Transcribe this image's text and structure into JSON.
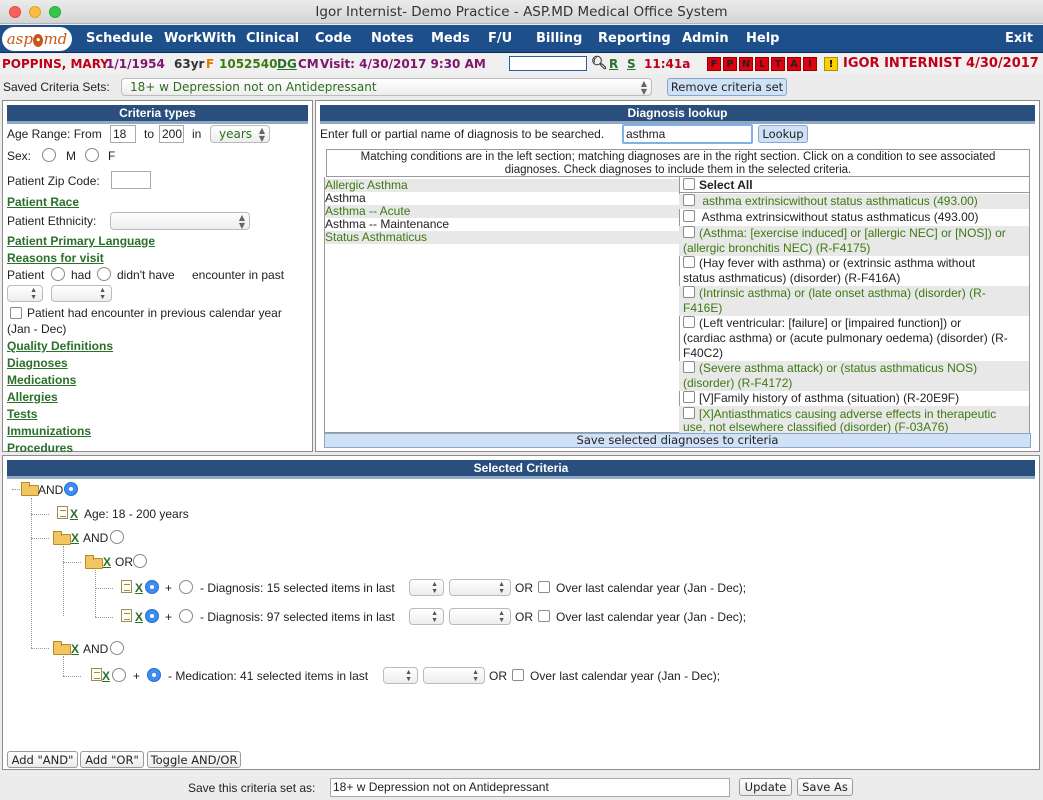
{
  "window": {
    "title": "Igor Internist- Demo Practice - ASP.MD Medical Office System"
  },
  "logo": {
    "text_left": "asp",
    "text_dot": "•",
    "text_right": "md"
  },
  "menu": [
    {
      "label": "Schedule"
    },
    {
      "label": "WorkWith"
    },
    {
      "label": "Clinical"
    },
    {
      "label": "Code"
    },
    {
      "label": "Notes"
    },
    {
      "label": "Meds"
    },
    {
      "label": "F/U"
    },
    {
      "label": "Billing"
    },
    {
      "label": "Reporting"
    },
    {
      "label": "Admin"
    },
    {
      "label": "Help"
    },
    {
      "label": "Exit"
    }
  ],
  "patient": {
    "name": "POPPINS, MARY",
    "dob": "1/1/1954",
    "age": "63yr",
    "sex": "F",
    "id": "1052540",
    "dg": "DG",
    "cm": "CM",
    "visit": "Visit: 4/30/2017 9:30 AM",
    "search_icon": "magnifier-icon",
    "r_link": "R",
    "s_link": "S",
    "time": "11:41a",
    "flags": [
      "F",
      "P",
      "N",
      "L",
      "T",
      "A",
      "I",
      "!"
    ],
    "provider": "IGOR INTERNIST 4/30/2017"
  },
  "saved": {
    "label": "Saved Criteria Sets:",
    "selected": "18+ w Depression not on Antidepressant",
    "remove_button": "Remove criteria set"
  },
  "criteria_types": {
    "header": "Criteria types",
    "age_label": "Age Range:  From",
    "age_from": "18",
    "to_label": "to",
    "age_to": "200",
    "in_label": "in",
    "unit": "years",
    "sex_label": "Sex:",
    "sex_m": "M",
    "sex_f": "F",
    "zip_label": "Patient Zip Code:",
    "race_link": "Patient Race",
    "ethnicity_label": "Patient Ethnicity:",
    "language_link": "Patient Primary Language",
    "reasons_link": "Reasons for visit",
    "patient_label": "Patient",
    "had_label": "had",
    "didnt_label": "didn't have",
    "encounter_label": "encounter in past",
    "prev_year_label": "Patient had encounter in previous calendar year",
    "prev_year_range": "(Jan - Dec)",
    "links": [
      "Quality Definitions",
      "Diagnoses",
      "Medications",
      "Allergies",
      "Tests",
      "Immunizations",
      "Procedures"
    ]
  },
  "diagnosis_lookup": {
    "header": "Diagnosis lookup",
    "prompt": "Enter full or partial name of diagnosis to be searched.",
    "query": "asthma",
    "lookup_button": "Lookup",
    "instructions_1": "Matching conditions are in the left section; matching diagnoses are in the right section. Click on a condition to see associated",
    "instructions_2": "diagnoses. Check diagnoses to include them in the selected criteria.",
    "conditions": [
      "Allergic Asthma",
      "Asthma",
      "Asthma -- Acute",
      "Asthma -- Maintenance",
      "Status Asthmaticus"
    ],
    "select_all": "Select All",
    "diagnoses": [
      {
        "lines": [
          "asthma extrinsicwithout status asthmaticus (493.00)"
        ]
      },
      {
        "lines": [
          "Asthma extrinsicwithout status asthmaticus (493.00)"
        ]
      },
      {
        "lines": [
          "(Asthma: [exercise induced] or [allergic NEC] or [NOS]) or",
          "(allergic bronchitis NEC) (R-F4175)"
        ]
      },
      {
        "lines": [
          "(Hay fever with asthma) or (extrinsic asthma without",
          "status asthmaticus) (disorder) (R-F416A)"
        ]
      },
      {
        "lines": [
          "(Intrinsic asthma) or (late onset asthma) (disorder) (R-",
          "F416E)"
        ]
      },
      {
        "lines": [
          "(Left ventricular: [failure] or [impaired function]) or",
          "(cardiac asthma) or (acute pulmonary oedema) (disorder) (R-",
          "F40C2)"
        ]
      },
      {
        "lines": [
          "(Severe asthma attack) or (status asthmaticus NOS)",
          "(disorder) (R-F4172)"
        ]
      },
      {
        "lines": [
          "[V]Family history of asthma (situation) (R-20E9F)"
        ]
      },
      {
        "lines": [
          "[X]Antiasthmatics causing adverse effects in therapeutic",
          "use, not elsewhere classified (disorder) (F-03A76)"
        ]
      }
    ],
    "save_button": "Save selected diagnoses to criteria"
  },
  "selected_criteria": {
    "header": "Selected Criteria",
    "root_op": "AND",
    "x": "X",
    "age_text": "Age: 18 - 200 years",
    "and_op": "AND",
    "or_op": "OR",
    "plus": "+",
    "minus": "-",
    "dx1_text": "- Diagnosis: 15 selected items in last",
    "dx2_text": "- Diagnosis: 97 selected items in last",
    "med_text": "- Medication: 41 selected items in last",
    "or_label": "OR",
    "over_last": "Over last calendar year (Jan - Dec);"
  },
  "footer": {
    "add_and": "Add \"AND\"",
    "add_or": "Add \"OR\"",
    "toggle": "Toggle AND/OR",
    "save_label": "Save this criteria set as:",
    "save_value": "18+ w Depression not on Antidepressant",
    "update": "Update",
    "save_as": "Save As"
  }
}
